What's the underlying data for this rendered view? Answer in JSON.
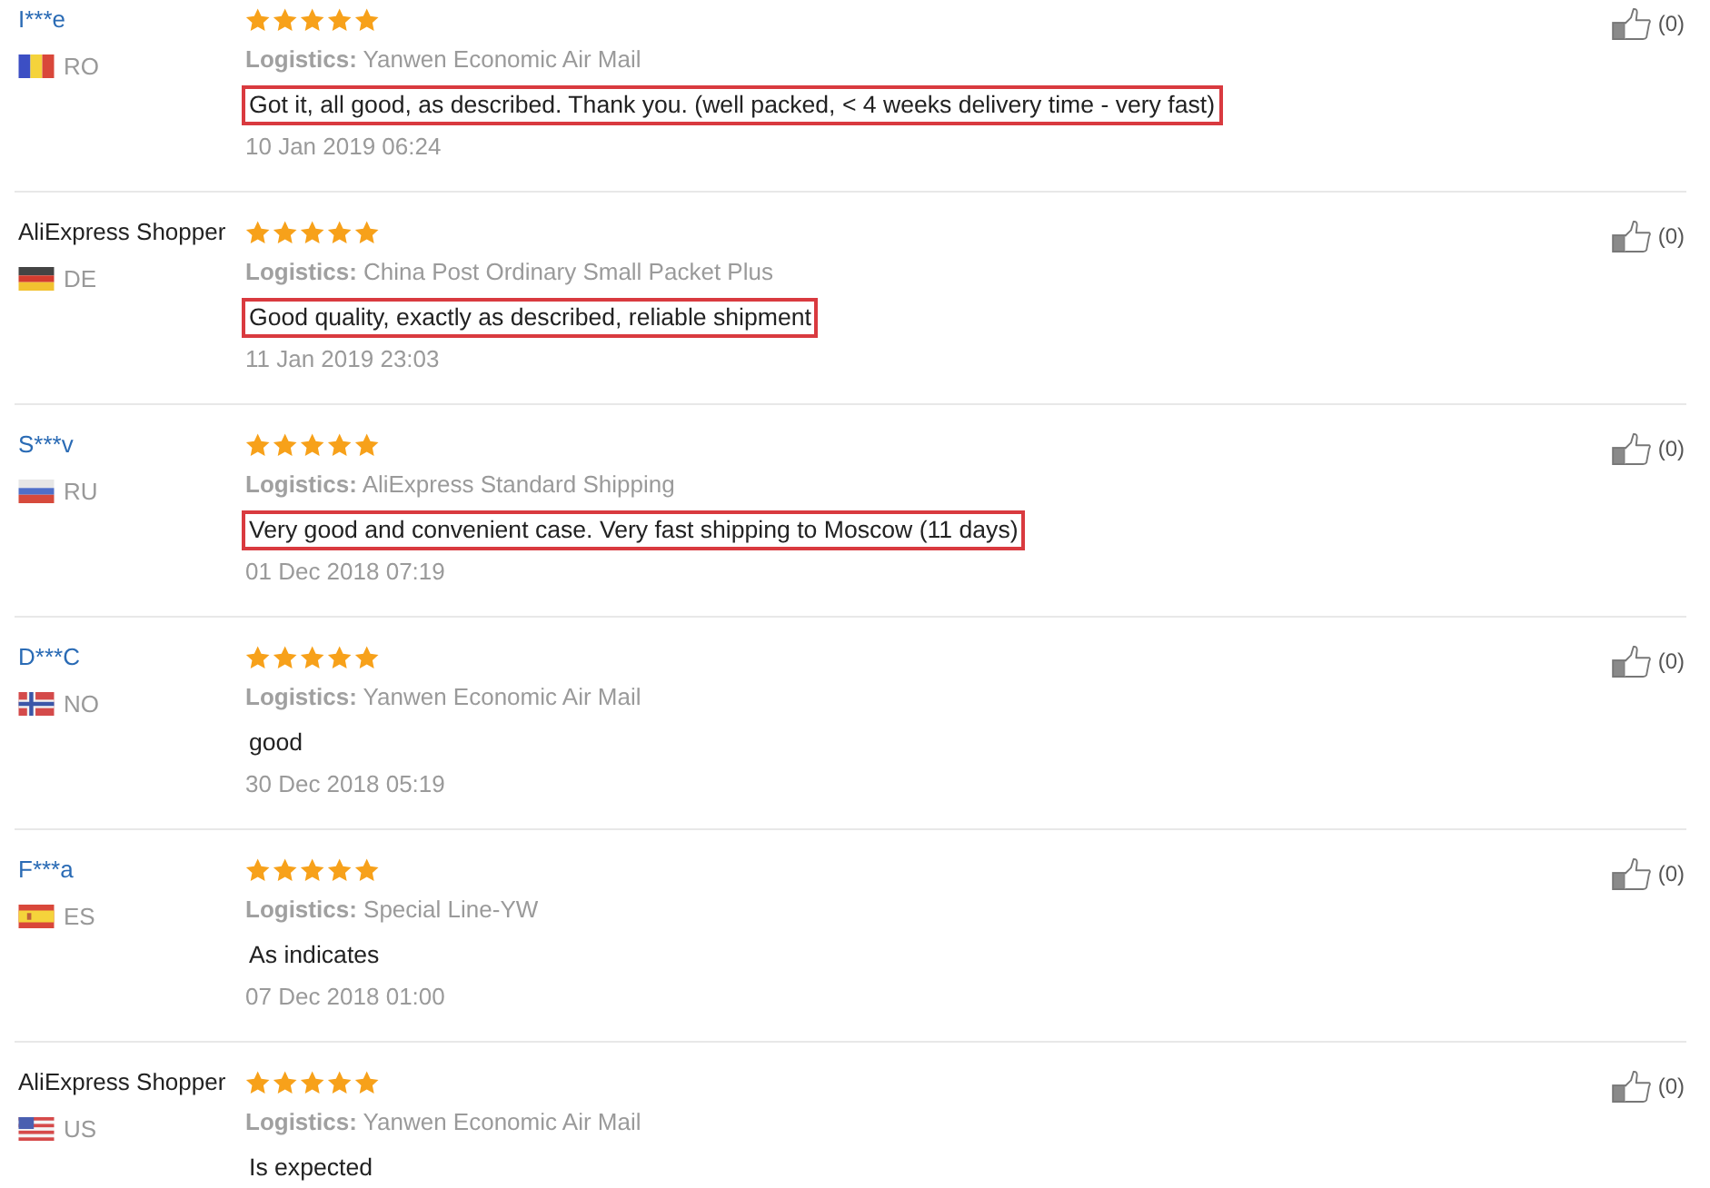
{
  "reviews": [
    {
      "reviewer": "I***e",
      "linked": true,
      "flag": {
        "kind": "ro"
      },
      "country": "RO",
      "stars": 5,
      "logistics_label": "Logistics:",
      "logistics": "Yanwen Economic Air Mail",
      "comment": "Got it, all good, as described. Thank you. (well packed, < 4 weeks delivery time - very fast)",
      "highlighted": true,
      "date": "10 Jan 2019 06:24",
      "helpful_count": "(0)"
    },
    {
      "reviewer": "AliExpress Shopper",
      "linked": false,
      "flag": {
        "kind": "de"
      },
      "country": "DE",
      "stars": 5,
      "logistics_label": "Logistics:",
      "logistics": "China Post Ordinary Small Packet Plus",
      "comment": "Good quality, exactly as described, reliable shipment",
      "highlighted": true,
      "date": "11 Jan 2019 23:03",
      "helpful_count": "(0)"
    },
    {
      "reviewer": "S***v",
      "linked": true,
      "flag": {
        "kind": "ru"
      },
      "country": "RU",
      "stars": 5,
      "logistics_label": "Logistics:",
      "logistics": "AliExpress Standard Shipping",
      "comment": "Very good and convenient case. Very fast shipping to Moscow (11 days)",
      "highlighted": true,
      "date": "01 Dec 2018 07:19",
      "helpful_count": "(0)"
    },
    {
      "reviewer": "D***C",
      "linked": true,
      "flag": {
        "kind": "no"
      },
      "country": "NO",
      "stars": 5,
      "logistics_label": "Logistics:",
      "logistics": "Yanwen Economic Air Mail",
      "comment": "good",
      "highlighted": false,
      "date": "30 Dec 2018 05:19",
      "helpful_count": "(0)"
    },
    {
      "reviewer": "F***a",
      "linked": true,
      "flag": {
        "kind": "es"
      },
      "country": "ES",
      "stars": 5,
      "logistics_label": "Logistics:",
      "logistics": "Special Line-YW",
      "comment": "As indicates",
      "highlighted": false,
      "date": "07 Dec 2018 01:00",
      "helpful_count": "(0)"
    },
    {
      "reviewer": "AliExpress Shopper",
      "linked": false,
      "flag": {
        "kind": "us"
      },
      "country": "US",
      "stars": 5,
      "logistics_label": "Logistics:",
      "logistics": "Yanwen Economic Air Mail",
      "comment": "Is expected",
      "highlighted": false,
      "helpful_count": "(0)"
    }
  ]
}
